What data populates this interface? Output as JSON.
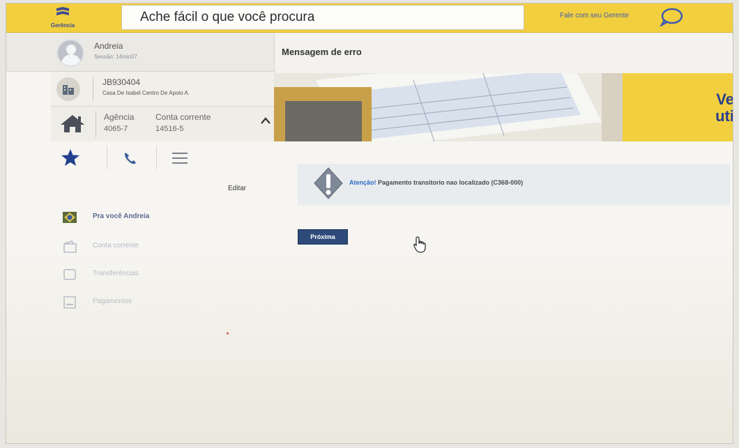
{
  "header": {
    "logo_text": "Gerência",
    "search_placeholder": "Ache fácil o que você procura",
    "chat_label": "Fale com seu Gerente"
  },
  "user": {
    "name": "Andreia",
    "session": "Sessão: 14min37"
  },
  "company": {
    "code": "JB930404",
    "name": "Casa De Isabel Centro De Apoio A."
  },
  "account": {
    "agency_label": "Agência",
    "agency_value": "4065-7",
    "account_label": "Conta corrente",
    "account_value": "14516-5"
  },
  "tabs": {
    "edit_label": "Editar"
  },
  "menu": [
    {
      "label": "Pra você Andreia"
    },
    {
      "label": "Conta corrente"
    },
    {
      "label": "Transferências"
    },
    {
      "label": "Pagamentos"
    }
  ],
  "main": {
    "title": "Mensagem de erro",
    "banner_text": "Ve uti",
    "alert_strong": "Atenção!",
    "alert_message": "Pagamento transitorio nao localizado (C368-000)",
    "next_button": "Próxima"
  },
  "colors": {
    "brand_yellow": "#f2cf3e",
    "brand_blue": "#2b3e8c",
    "button_blue": "#2e4a7a"
  }
}
